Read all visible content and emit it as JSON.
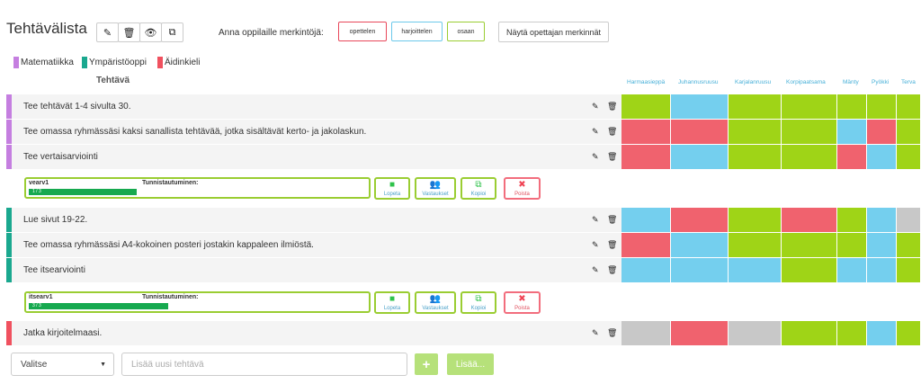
{
  "header": {
    "title": "Tehtävälista",
    "toolbar_icons": [
      "pencil-icon",
      "trash-icon",
      "eye-icon",
      "copy-icon"
    ],
    "marks_label": "Anna oppilaille merkintöjä:",
    "mark_buttons": [
      {
        "label": "opettelen",
        "color": "#e8475a"
      },
      {
        "label": "harjoittelen",
        "color": "#6cc9ea"
      },
      {
        "label": "osaan",
        "color": "#9acd32"
      }
    ],
    "show_teacher_marks": "Näytä opettajan merkinnät"
  },
  "legend": [
    {
      "label": "Matematiikka",
      "color": "#c57fe0"
    },
    {
      "label": "Ympäristöoppi",
      "color": "#1aa88f"
    },
    {
      "label": "Äidinkieli",
      "color": "#f0515f"
    }
  ],
  "table": {
    "task_header": "Tehtävä",
    "students": [
      "Harmaasieppä",
      "Juhannusruusu",
      "Karjalanruusu",
      "Korpipaatsama",
      "Mänty",
      "Pyökki",
      "Terva"
    ]
  },
  "colors": {
    "r": "#f0626e",
    "b": "#74cfee",
    "g": "#9fd417",
    "x": "#c8c8c8"
  },
  "tasks": [
    {
      "text": "Tee tehtävät 1-4 sivulta 30.",
      "subject_color": "#c57fe0",
      "marks": [
        "g",
        "b",
        "g",
        "g",
        "g",
        "g",
        "g"
      ]
    },
    {
      "text": "Tee omassa ryhmässäsi kaksi sanallista tehtävää, jotka sisältävät kerto- ja jakolaskun.",
      "subject_color": "#c57fe0",
      "marks": [
        "r",
        "r",
        "g",
        "g",
        "b",
        "r",
        "g"
      ]
    },
    {
      "text": "Tee vertaisarviointi",
      "subject_color": "#c57fe0",
      "marks": [
        "r",
        "b",
        "g",
        "g",
        "r",
        "b",
        "g"
      ]
    },
    {
      "text": "Lue sivut 19-22.",
      "subject_color": "#1aa88f",
      "marks": [
        "b",
        "r",
        "g",
        "r",
        "g",
        "b",
        "x"
      ]
    },
    {
      "text": "Tee omassa ryhmässäsi A4-kokoinen posteri jostakin kappaleen ilmiöstä.",
      "subject_color": "#1aa88f",
      "marks": [
        "r",
        "b",
        "g",
        "g",
        "g",
        "b",
        "g"
      ]
    },
    {
      "text": "Tee itsearviointi",
      "subject_color": "#1aa88f",
      "marks": [
        "b",
        "b",
        "b",
        "g",
        "b",
        "b",
        "g"
      ]
    },
    {
      "text": "Jatka kirjoitelmaasi.",
      "subject_color": "#f0515f",
      "marks": [
        "x",
        "r",
        "x",
        "g",
        "g",
        "b",
        "g"
      ]
    }
  ],
  "panels": [
    {
      "name": "vearv1",
      "identification": "Tunnistautuminen:",
      "progress": 0.3,
      "progress_text": "1 / 3",
      "actions": [
        "Lopeta",
        "Vastaukset",
        "Kopioi",
        "Poista"
      ]
    },
    {
      "name": "itsearv1",
      "identification": "Tunnistautuminen:",
      "progress": 1.0,
      "progress_text": "3 / 3",
      "actions": [
        "Lopeta",
        "Vastaukset",
        "Kopioi",
        "Poista"
      ]
    }
  ],
  "footer": {
    "select_value": "Valitse",
    "new_task_placeholder": "Lisää uusi tehtävä",
    "add_symbol": "+",
    "more_label": "Lisää..."
  }
}
